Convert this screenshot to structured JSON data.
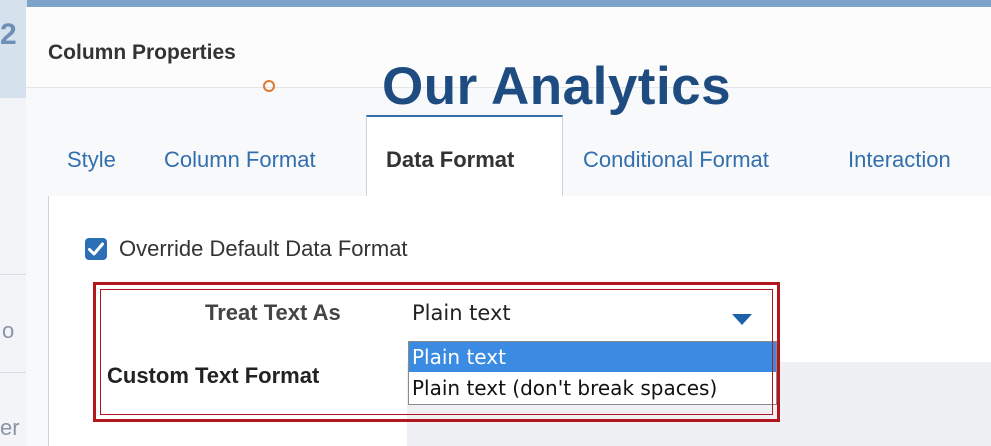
{
  "dialog": {
    "title": "Column Properties"
  },
  "brand": {
    "text": "Our Analytics",
    "color": "#1f4c80"
  },
  "tabs": [
    {
      "label": "Style",
      "active": false
    },
    {
      "label": "Column Format",
      "active": false
    },
    {
      "label": "Data Format",
      "active": true
    },
    {
      "label": "Conditional Format",
      "active": false
    },
    {
      "label": "Interaction",
      "active": false
    }
  ],
  "data_format": {
    "override_label": "Override Default Data Format",
    "override_checked": true,
    "treat_text_as_label": "Treat Text As",
    "treat_text_as_value": "Plain text",
    "custom_text_format_label": "Custom Text Format",
    "options": [
      "Plain text",
      "Plain text (don't break spaces)"
    ],
    "highlight_color": "#b2161e"
  },
  "background": {
    "glyphs": [
      "2",
      "o",
      "er"
    ]
  }
}
